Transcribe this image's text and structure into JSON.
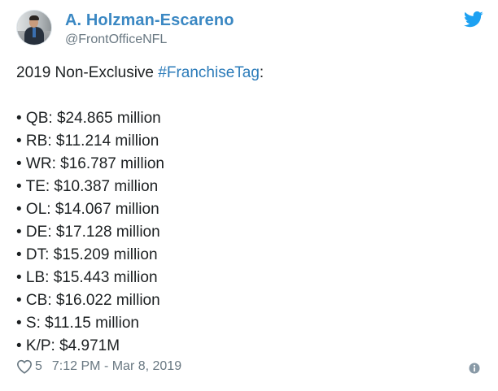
{
  "user": {
    "display_name": "A. Holzman-Escareno",
    "handle": "@FrontOfficeNFL"
  },
  "tweet": {
    "intro_prefix": "2019 Non-Exclusive ",
    "hashtag": "#FranchiseTag",
    "intro_suffix": ":",
    "items": [
      "• QB: $24.865 million",
      "• RB: $11.214 million",
      "• WR: $16.787 million",
      "• TE: $10.387 million",
      "• OL: $14.067 million",
      "• DE: $17.128 million",
      "• DT: $15.209 million",
      "• LB: $15.443 million",
      "• CB: $16.022 million",
      "• S: $11.15 million",
      "• K/P: $4.971M"
    ]
  },
  "footer": {
    "like_count": "5",
    "timestamp": "7:12 PM - Mar 8, 2019"
  },
  "colors": {
    "name": "#3b88c3",
    "hashtag": "#2b7bb9",
    "twitter_bird": "#1da1f2",
    "meta_text": "#697882"
  },
  "icons": {
    "bird": "twitter-bird-icon",
    "heart": "heart-icon",
    "info": "info-icon"
  }
}
